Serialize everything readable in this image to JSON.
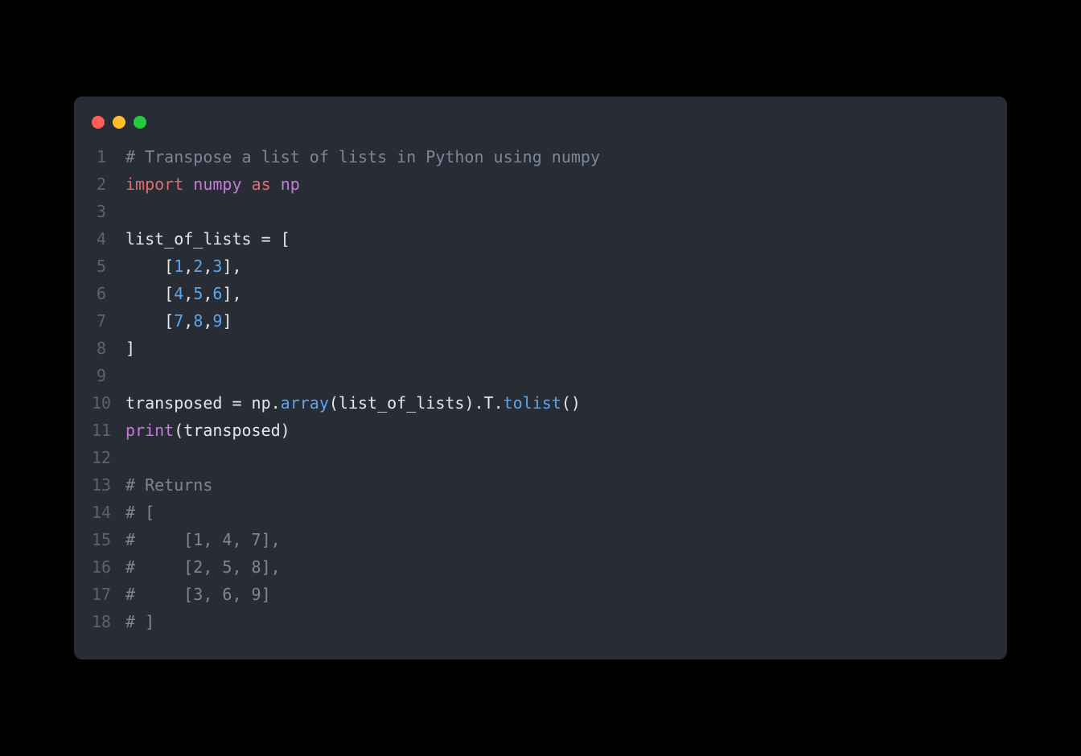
{
  "window": {
    "buttons": [
      "close",
      "minimize",
      "zoom"
    ]
  },
  "code": {
    "lines": [
      {
        "n": "1",
        "tokens": [
          {
            "cls": "tok-comment",
            "t": "# Transpose a list of lists in Python using numpy"
          }
        ]
      },
      {
        "n": "2",
        "tokens": [
          {
            "cls": "tok-import",
            "t": "import"
          },
          {
            "cls": "tok-punct",
            "t": " "
          },
          {
            "cls": "tok-module",
            "t": "numpy"
          },
          {
            "cls": "tok-punct",
            "t": " "
          },
          {
            "cls": "tok-import",
            "t": "as"
          },
          {
            "cls": "tok-punct",
            "t": " "
          },
          {
            "cls": "tok-module",
            "t": "np"
          }
        ]
      },
      {
        "n": "3",
        "tokens": []
      },
      {
        "n": "4",
        "tokens": [
          {
            "cls": "tok-ident",
            "t": "list_of_lists "
          },
          {
            "cls": "tok-op",
            "t": "="
          },
          {
            "cls": "tok-punct",
            "t": " ["
          }
        ]
      },
      {
        "n": "5",
        "tokens": [
          {
            "cls": "tok-punct",
            "t": "    ["
          },
          {
            "cls": "tok-num",
            "t": "1"
          },
          {
            "cls": "tok-punct",
            "t": ","
          },
          {
            "cls": "tok-num",
            "t": "2"
          },
          {
            "cls": "tok-punct",
            "t": ","
          },
          {
            "cls": "tok-num",
            "t": "3"
          },
          {
            "cls": "tok-punct",
            "t": "],"
          }
        ]
      },
      {
        "n": "6",
        "tokens": [
          {
            "cls": "tok-punct",
            "t": "    ["
          },
          {
            "cls": "tok-num",
            "t": "4"
          },
          {
            "cls": "tok-punct",
            "t": ","
          },
          {
            "cls": "tok-num",
            "t": "5"
          },
          {
            "cls": "tok-punct",
            "t": ","
          },
          {
            "cls": "tok-num",
            "t": "6"
          },
          {
            "cls": "tok-punct",
            "t": "],"
          }
        ]
      },
      {
        "n": "7",
        "tokens": [
          {
            "cls": "tok-punct",
            "t": "    ["
          },
          {
            "cls": "tok-num",
            "t": "7"
          },
          {
            "cls": "tok-punct",
            "t": ","
          },
          {
            "cls": "tok-num",
            "t": "8"
          },
          {
            "cls": "tok-punct",
            "t": ","
          },
          {
            "cls": "tok-num",
            "t": "9"
          },
          {
            "cls": "tok-punct",
            "t": "]"
          }
        ]
      },
      {
        "n": "8",
        "tokens": [
          {
            "cls": "tok-punct",
            "t": "]"
          }
        ]
      },
      {
        "n": "9",
        "tokens": []
      },
      {
        "n": "10",
        "tokens": [
          {
            "cls": "tok-ident",
            "t": "transposed "
          },
          {
            "cls": "tok-op",
            "t": "="
          },
          {
            "cls": "tok-ident",
            "t": " np"
          },
          {
            "cls": "tok-punct",
            "t": "."
          },
          {
            "cls": "tok-method",
            "t": "array"
          },
          {
            "cls": "tok-punct",
            "t": "(list_of_lists)."
          },
          {
            "cls": "tok-ident",
            "t": "T"
          },
          {
            "cls": "tok-punct",
            "t": "."
          },
          {
            "cls": "tok-method",
            "t": "tolist"
          },
          {
            "cls": "tok-punct",
            "t": "()"
          }
        ]
      },
      {
        "n": "11",
        "tokens": [
          {
            "cls": "tok-func",
            "t": "print"
          },
          {
            "cls": "tok-punct",
            "t": "(transposed)"
          }
        ]
      },
      {
        "n": "12",
        "tokens": []
      },
      {
        "n": "13",
        "tokens": [
          {
            "cls": "tok-comment",
            "t": "# Returns"
          }
        ]
      },
      {
        "n": "14",
        "tokens": [
          {
            "cls": "tok-comment",
            "t": "# ["
          }
        ]
      },
      {
        "n": "15",
        "tokens": [
          {
            "cls": "tok-comment",
            "t": "#     [1, 4, 7],"
          }
        ]
      },
      {
        "n": "16",
        "tokens": [
          {
            "cls": "tok-comment",
            "t": "#     [2, 5, 8],"
          }
        ]
      },
      {
        "n": "17",
        "tokens": [
          {
            "cls": "tok-comment",
            "t": "#     [3, 6, 9]"
          }
        ]
      },
      {
        "n": "18",
        "tokens": [
          {
            "cls": "tok-comment",
            "t": "# ]"
          }
        ]
      }
    ]
  }
}
